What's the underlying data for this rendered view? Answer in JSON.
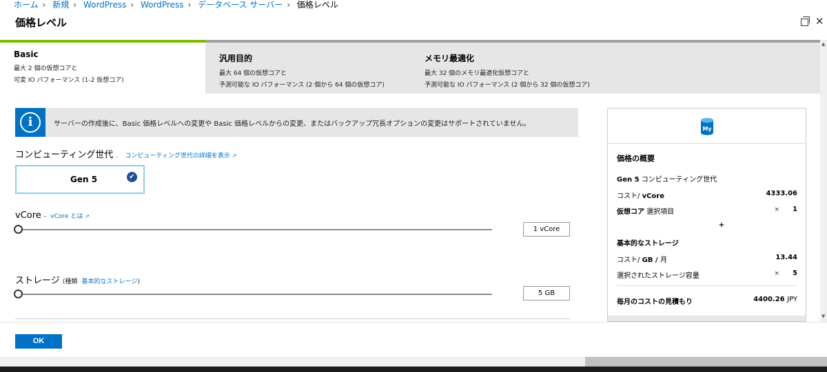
{
  "breadcrumb": [
    "ホーム",
    "新規",
    "WordPress",
    "WordPress",
    "データベース サーバー",
    "価格レベル"
  ],
  "blade": {
    "title": "価格レベル"
  },
  "tabs": [
    {
      "name": "Basic",
      "line1": "最大 2 個の仮想コアと",
      "line2": "可変 IO パフォーマンス (1-2 仮想コア)"
    },
    {
      "name": "汎用目的",
      "line1": "最大 64 個の仮想コアと",
      "line2": "予測可能な IO パフォーマンス (2 個から 64 個の仮想コア)"
    },
    {
      "name": "メモリ最適化",
      "line1": "最大 32 個のメモリ最適化仮想コアと",
      "line2": "予測可能な IO パフォーマンス (2 個から 32 個の仮想コア)"
    }
  ],
  "info": {
    "message": "サーバーの作成後に、Basic 価格レベルへの変更や Basic 価格レベルからの変更、またはバックアップ冗長オプションの変更はサポートされていません。"
  },
  "compute": {
    "label": "コンピューティング世代",
    "dot": ".",
    "link": "コンピューティング世代の詳細を表示",
    "gen_label": "Gen 5"
  },
  "vcore": {
    "label": "vCore",
    "dash": "-",
    "link": "vCore とは",
    "value": "1 vCore",
    "level": 0
  },
  "storage": {
    "label": "ストレージ",
    "type_open": "(種類",
    "type_link": "基本的なストレージ",
    "type_close": ")",
    "value": "5 GB",
    "level": 0
  },
  "summary": {
    "title": "価格の概要",
    "gen_bold": "Gen 5",
    "gen_rest": " コンピューティング世代",
    "cost_vcore_label": "コスト/ ",
    "cost_vcore_unit": "vCore",
    "cost_vcore_value": "4333.06",
    "vcore_bold": "仮想コア",
    "vcore_rest": " 選択項目",
    "times": "×",
    "vcore_count": "1",
    "plus": "+",
    "storage_title": "基本的なストレージ",
    "cost_gb_label": "コスト/ ",
    "cost_gb_unit": "GB / ",
    "cost_gb_month": "月",
    "cost_gb_value": "13.44",
    "storage_sel_label": "選択されたストレージ容量",
    "storage_count": "5",
    "monthly_label": "毎月のコストの見積もり",
    "monthly_value": "4400.26",
    "currency": "JPY"
  },
  "footer": {
    "ok_label": "OK"
  },
  "colors": {
    "accent": "#0072c6",
    "selected_tab": "#7fba00",
    "link": "#0072c6"
  }
}
